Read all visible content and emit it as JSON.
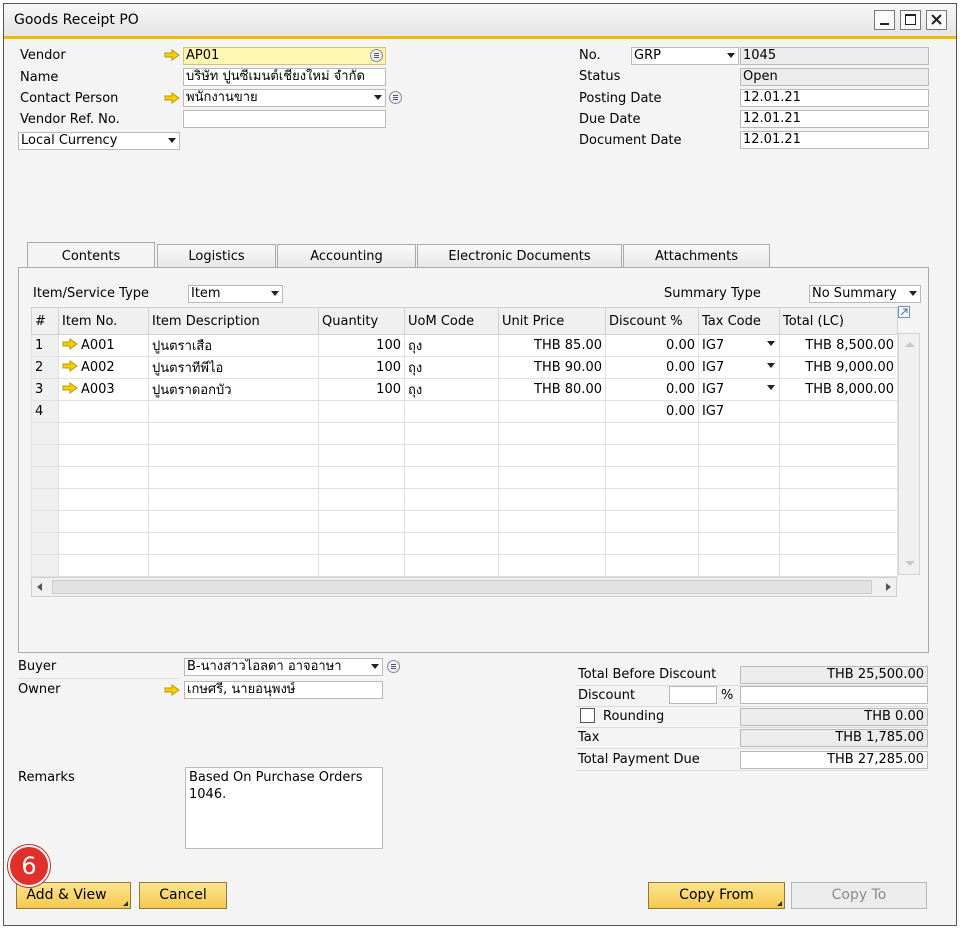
{
  "window": {
    "title": "Goods Receipt PO"
  },
  "header_left": {
    "vendor_label": "Vendor",
    "vendor_value": "AP01",
    "name_label": "Name",
    "name_value": "บริษัท ปูนซีเมนต์เชียงใหม่ จำกัด",
    "contact_label": "Contact Person",
    "contact_value": "พนักงานขาย",
    "vendor_ref_label": "Vendor Ref. No.",
    "vendor_ref_value": "",
    "currency_value": "Local Currency"
  },
  "header_right": {
    "no_label": "No.",
    "series_value": "GRP",
    "no_value": "1045",
    "status_label": "Status",
    "status_value": "Open",
    "posting_label": "Posting Date",
    "posting_value": "12.01.21",
    "due_label": "Due Date",
    "due_value": "12.01.21",
    "docdate_label": "Document Date",
    "docdate_value": "12.01.21"
  },
  "tabs": [
    "Contents",
    "Logistics",
    "Accounting",
    "Electronic Documents",
    "Attachments"
  ],
  "contents": {
    "item_type_label": "Item/Service Type",
    "item_type_value": "Item",
    "summary_label": "Summary Type",
    "summary_value": "No Summary",
    "columns": [
      "#",
      "Item No.",
      "Item Description",
      "Quantity",
      "UoM Code",
      "Unit Price",
      "Discount %",
      "Tax Code",
      "Total (LC)"
    ],
    "rows": [
      [
        "1",
        "A001",
        "ปูนตราเสือ",
        "100",
        "ถุง",
        "THB 85.00",
        "0.00",
        "IG7",
        "THB 8,500.00"
      ],
      [
        "2",
        "A002",
        "ปูนตราทีพีไอ",
        "100",
        "ถุง",
        "THB 90.00",
        "0.00",
        "IG7",
        "THB 9,000.00"
      ],
      [
        "3",
        "A003",
        "ปูนตราดอกบัว",
        "100",
        "ถุง",
        "THB 80.00",
        "0.00",
        "IG7",
        "THB 8,000.00"
      ],
      [
        "4",
        "",
        "",
        "",
        "",
        "",
        "0.00",
        "IG7",
        ""
      ]
    ]
  },
  "footer_left": {
    "buyer_label": "Buyer",
    "buyer_value": "B-นางสาวไอลดา อาจอาษา",
    "owner_label": "Owner",
    "owner_value": "เกษศรี, นายอนุพงษ์",
    "remarks_label": "Remarks",
    "remarks_value": "Based On Purchase Orders 1046."
  },
  "totals": {
    "before_discount_label": "Total Before Discount",
    "before_discount_value": "THB 25,500.00",
    "discount_label": "Discount",
    "discount_pct": "",
    "pct_sign": "%",
    "discount_value": "",
    "rounding_label": "Rounding",
    "rounding_value": "THB 0.00",
    "tax_label": "Tax",
    "tax_value": "THB 1,785.00",
    "total_due_label": "Total Payment Due",
    "total_due_value": "THB 27,285.00"
  },
  "buttons": {
    "add_view": "Add & View",
    "cancel": "Cancel",
    "copy_from": "Copy From",
    "copy_to": "Copy To"
  },
  "step_badge": "6",
  "colors": {
    "accent": "#f0b800",
    "button": "#f6c850",
    "required_field": "#fff6b3"
  }
}
